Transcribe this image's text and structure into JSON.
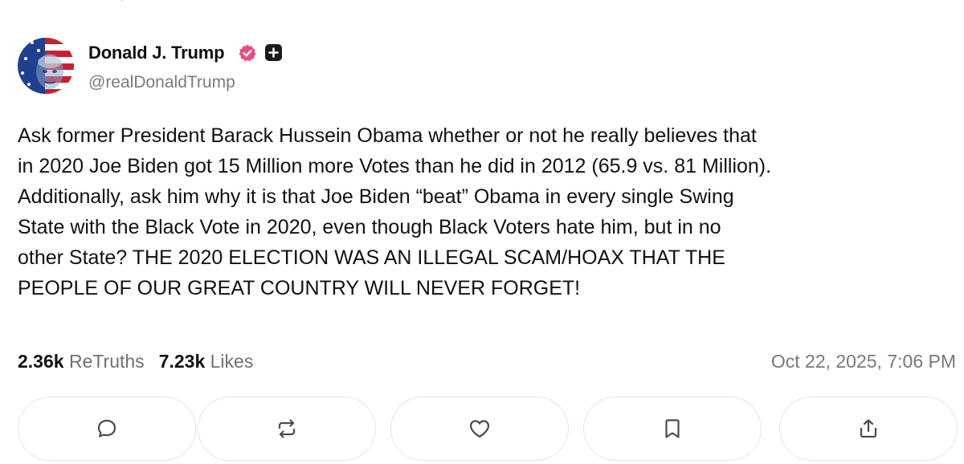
{
  "post": {
    "author": {
      "name": "Donald J. Trump",
      "handle": "@realDonaldTrump",
      "verified_badge_color": "#ec4c7b",
      "avatar_description": "flag-themed profile photo"
    },
    "body_lines": [
      "Ask former President Barack Hussein Obama whether or not he really believes that",
      "in 2020 Joe Biden got 15 Million more Votes than he did in 2012 (65.9 vs. 81 Million).",
      "Additionally, ask him why it is that Joe Biden “beat” Obama in every single Swing",
      "State with the Black Vote in 2020, even though Black Voters hate him, but in no",
      "other State? THE 2020 ELECTION WAS AN ILLEGAL SCAM/HOAX THAT THE",
      "PEOPLE OF OUR GREAT COUNTRY WILL NEVER FORGET!"
    ],
    "stats": {
      "retruths_count": "2.36k",
      "retruths_label": "ReTruths",
      "likes_count": "7.23k",
      "likes_label": "Likes"
    },
    "timestamp": "Oct 22, 2025, 7:06 PM"
  },
  "actions": [
    {
      "id": "reply",
      "icon": "comment-bubble-icon"
    },
    {
      "id": "retruth",
      "icon": "retruth-arrows-icon"
    },
    {
      "id": "like",
      "icon": "heart-icon"
    },
    {
      "id": "bookmark",
      "icon": "bookmark-icon"
    },
    {
      "id": "share",
      "icon": "share-upload-icon"
    }
  ],
  "colors": {
    "text": "#111111",
    "muted": "#77777e",
    "border": "#e4e4e8",
    "icon": "#4a4a52"
  }
}
